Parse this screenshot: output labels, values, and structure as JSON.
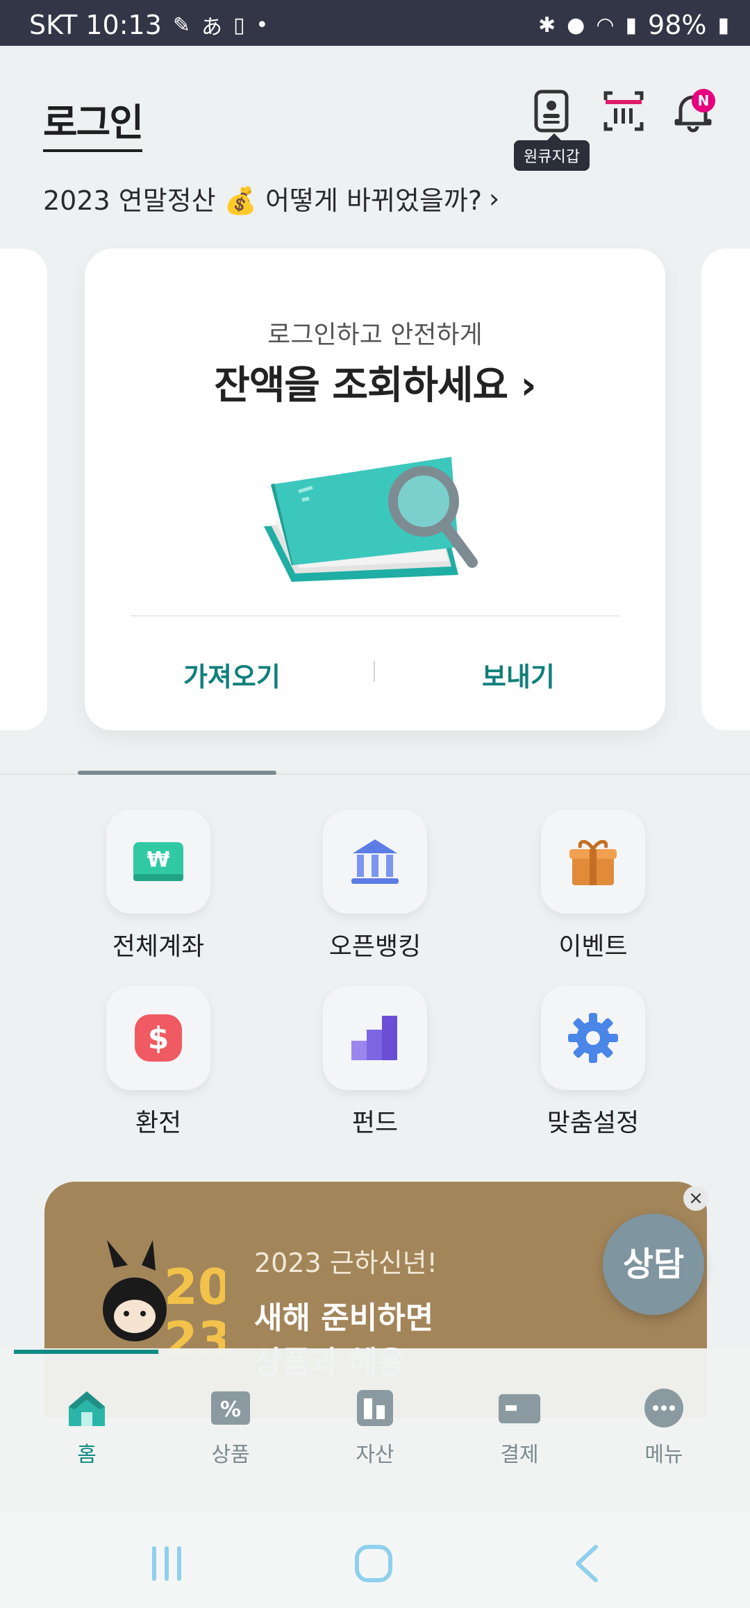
{
  "status_bar": {
    "carrier_time": "SKT 10:13",
    "ime": "あ",
    "battery": "98%"
  },
  "header": {
    "title": "로그인",
    "wallet_tooltip": "원큐지갑",
    "notification_badge": "N"
  },
  "notice": {
    "text": "2023 연말정산 💰 어떻게 바뀌었을까?",
    "chevron": "›"
  },
  "balance_card": {
    "subtitle": "로그인하고 안전하게",
    "title": "잔액을 조회하세요 ›",
    "action_left": "가져오기",
    "action_right": "보내기"
  },
  "quick_menu": [
    {
      "label": "전체계좌",
      "icon": "won-card-icon"
    },
    {
      "label": "오픈뱅킹",
      "icon": "bank-icon"
    },
    {
      "label": "이벤트",
      "icon": "gift-icon"
    },
    {
      "label": "환전",
      "icon": "dollar-icon"
    },
    {
      "label": "펀드",
      "icon": "fund-chart-icon"
    },
    {
      "label": "맞춤설정",
      "icon": "gear-icon"
    }
  ],
  "banner": {
    "small_text": "2023 근하신년!",
    "big_text_line1": "새해 준비하면",
    "big_text_line2": "상품과 혜용",
    "close": "×"
  },
  "consult_button": "상담",
  "bottom_nav": [
    {
      "label": "홈",
      "icon": "home-icon",
      "active": true
    },
    {
      "label": "상품",
      "icon": "product-icon",
      "active": false
    },
    {
      "label": "자산",
      "icon": "asset-icon",
      "active": false
    },
    {
      "label": "결제",
      "icon": "payment-icon",
      "active": false
    },
    {
      "label": "메뉴",
      "icon": "menu-icon",
      "active": false
    }
  ],
  "colors": {
    "accent": "#0f8a84",
    "banner": "#a3855a",
    "badge": "#e6007e"
  }
}
